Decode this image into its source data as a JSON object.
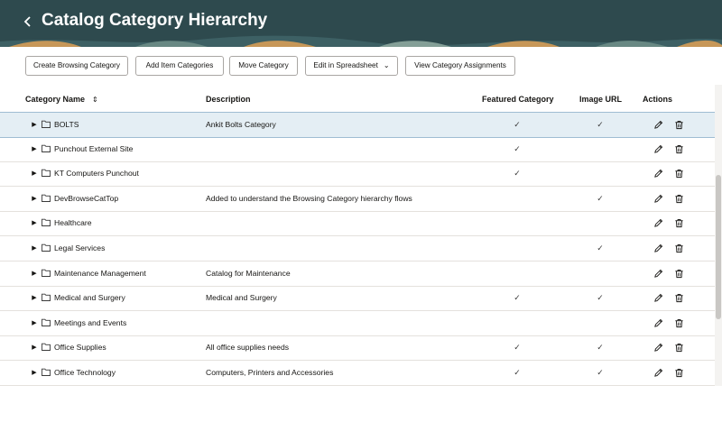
{
  "page": {
    "title": "Catalog Category Hierarchy",
    "back_icon": "chevron-left-icon"
  },
  "colors": {
    "header_bg": "#2e4a4e",
    "selected_row_bg": "#e4eef4",
    "pattern_accent": "#d8a05a"
  },
  "toolbar": {
    "create_browsing_category": "Create Browsing Category",
    "add_item_categories": "Add Item Categories",
    "move_category": "Move Category",
    "edit_in_spreadsheet": "Edit in Spreadsheet",
    "view_category_assignments": "View Category Assignments"
  },
  "table": {
    "columns": {
      "name": "Category Name",
      "description": "Description",
      "featured": "Featured Category",
      "image_url": "Image URL",
      "actions": "Actions"
    },
    "rows": [
      {
        "name": "BOLTS",
        "description": "Ankit Bolts Category",
        "featured": true,
        "image": true,
        "selected": true
      },
      {
        "name": "Punchout External Site",
        "description": "",
        "featured": true,
        "image": false
      },
      {
        "name": "KT Computers Punchout",
        "description": "",
        "featured": true,
        "image": false
      },
      {
        "name": "DevBrowseCatTop",
        "description": "Added to understand the Browsing Category hierarchy flows",
        "featured": false,
        "image": true
      },
      {
        "name": "Healthcare",
        "description": "",
        "featured": false,
        "image": false
      },
      {
        "name": "Legal Services",
        "description": "",
        "featured": false,
        "image": true
      },
      {
        "name": "Maintenance Management",
        "description": "Catalog for Maintenance",
        "featured": false,
        "image": false
      },
      {
        "name": "Medical and Surgery",
        "description": "Medical and Surgery",
        "featured": true,
        "image": true
      },
      {
        "name": "Meetings and Events",
        "description": "",
        "featured": false,
        "image": false
      },
      {
        "name": "Office Supplies",
        "description": "All office supplies needs",
        "featured": true,
        "image": true
      },
      {
        "name": "Office Technology",
        "description": "Computers, Printers and Accessories",
        "featured": true,
        "image": true
      }
    ]
  }
}
